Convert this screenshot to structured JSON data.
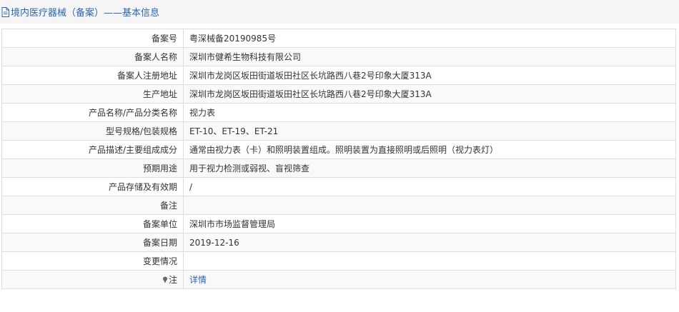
{
  "header": {
    "title": "境内医疗器械（备案）——基本信息",
    "icon": "document-icon"
  },
  "rows": [
    {
      "label": "备案号",
      "value": "粤深械备20190985号"
    },
    {
      "label": "备案人名称",
      "value": "深圳市健希生物科技有限公司"
    },
    {
      "label": "备案人注册地址",
      "value": "深圳市龙岗区坂田街道坂田社区长坑路西八巷2号印象大厦313A"
    },
    {
      "label": "生产地址",
      "value": "深圳市龙岗区坂田街道坂田社区长坑路西八巷2号印象大厦313A"
    },
    {
      "label": "产品名称/产品分类名称",
      "value": "视力表"
    },
    {
      "label": "型号规格/包装规格",
      "value": "ET-10、ET-19、ET-21"
    },
    {
      "label": "产品描述/主要组成成分",
      "value": "通常由视力表（卡）和照明装置组成。照明装置为直接照明或后照明（视力表灯）"
    },
    {
      "label": "预期用途",
      "value": "用于视力检测或弱视、盲视筛查"
    },
    {
      "label": "产品存储及有效期",
      "value": "/"
    },
    {
      "label": "备注",
      "value": ""
    },
    {
      "label": "备案单位",
      "value": "深圳市市场监督管理局"
    },
    {
      "label": "备案日期",
      "value": "2019-12-16"
    },
    {
      "label": "变更情况",
      "value": ""
    }
  ],
  "note": {
    "label": "注",
    "icon": "pin-icon",
    "link": "详情"
  }
}
